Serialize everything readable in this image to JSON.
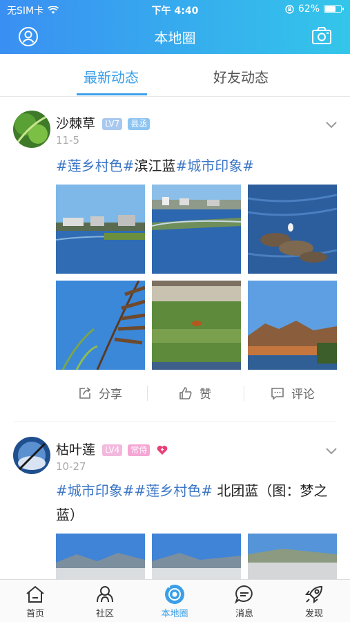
{
  "status_bar": {
    "carrier": "无SIM卡",
    "time": "下午 4:40",
    "battery": "62%",
    "battery_level": 0.62
  },
  "header": {
    "title": "本地圈",
    "left_icon": "profile-icon",
    "right_icon": "camera-icon"
  },
  "tabs": [
    {
      "label": "最新动态",
      "active": true
    },
    {
      "label": "好友动态",
      "active": false
    }
  ],
  "posts": [
    {
      "username": "沙棘草",
      "level": "LV7",
      "role": "县丞",
      "date": "11-5",
      "tags": [
        "#莲乡村色#",
        "滨江蓝",
        "#城市印象#"
      ],
      "content_parts": [
        {
          "text": "#莲乡村色#",
          "tag": true
        },
        {
          "text": "滨江蓝",
          "tag": false
        },
        {
          "text": "#城市印象#",
          "tag": true
        }
      ],
      "image_count": 6,
      "actions": {
        "share": "分享",
        "like": "赞",
        "comment": "评论"
      }
    },
    {
      "username": "枯叶莲",
      "level": "LV4",
      "role": "常侍",
      "date": "10-27",
      "content_parts": [
        {
          "text": "#城市印象##莲乡村色#",
          "tag": true
        },
        {
          "text": " 北团蓝（图：梦之蓝）",
          "tag": false
        }
      ],
      "image_count": 3
    }
  ],
  "bottom_nav": [
    {
      "label": "首页",
      "icon": "home-icon"
    },
    {
      "label": "社区",
      "icon": "community-icon"
    },
    {
      "label": "本地圈",
      "icon": "local-circle-icon",
      "active": true
    },
    {
      "label": "消息",
      "icon": "message-icon"
    },
    {
      "label": "发现",
      "icon": "rocket-icon"
    }
  ],
  "colors": {
    "accent": "#3a9fe8",
    "tag": "#3b76c5",
    "header_start": "#3a8ff2",
    "header_end": "#33c6ea"
  }
}
